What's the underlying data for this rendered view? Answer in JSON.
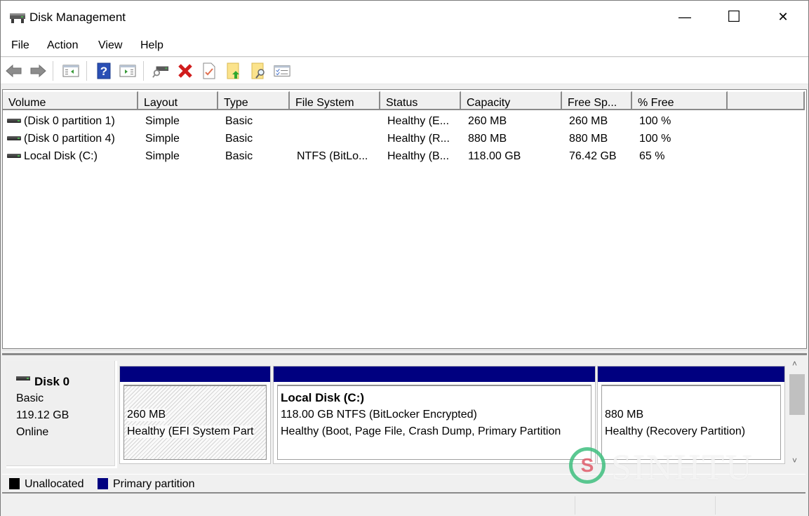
{
  "window": {
    "title": "Disk Management",
    "app_icon": "disk-management-icon",
    "controls": {
      "minimize": "—",
      "maximize": "☐",
      "close": "✕"
    }
  },
  "menu": [
    "File",
    "Action",
    "View",
    "Help"
  ],
  "toolbar": {
    "buttons": [
      {
        "icon": "back-arrow-icon"
      },
      {
        "icon": "forward-arrow-icon"
      },
      {
        "icon": "show-hide-console-tree-icon"
      },
      {
        "icon": "help-icon",
        "glyph": "?"
      },
      {
        "icon": "show-hide-action-pane-icon"
      },
      {
        "icon": "connect-virtual-disk-icon"
      },
      {
        "icon": "delete-icon",
        "glyph": "✖"
      },
      {
        "icon": "properties-icon",
        "glyph": "✓"
      },
      {
        "icon": "import-folder-icon",
        "glyph": "↑"
      },
      {
        "icon": "find-folder-icon"
      },
      {
        "icon": "checklist-icon"
      }
    ]
  },
  "volume_list": {
    "columns": [
      "Volume",
      "Layout",
      "Type",
      "File System",
      "Status",
      "Capacity",
      "Free Sp...",
      "% Free",
      ""
    ],
    "rows": [
      {
        "volume": "(Disk 0 partition 1)",
        "layout": "Simple",
        "type": "Basic",
        "file_system": "",
        "status": "Healthy (E...",
        "capacity": "260 MB",
        "free_space": "260 MB",
        "percent_free": "100 %"
      },
      {
        "volume": "(Disk 0 partition 4)",
        "layout": "Simple",
        "type": "Basic",
        "file_system": "",
        "status": "Healthy (R...",
        "capacity": "880 MB",
        "free_space": "880 MB",
        "percent_free": "100 %"
      },
      {
        "volume": "Local Disk (C:)",
        "layout": "Simple",
        "type": "Basic",
        "file_system": "NTFS (BitLo...",
        "status": "Healthy (B...",
        "capacity": "118.00 GB",
        "free_space": "76.42 GB",
        "percent_free": "65 %"
      }
    ]
  },
  "disk": {
    "name": "Disk 0",
    "type": "Basic",
    "size": "119.12 GB",
    "state": "Online",
    "partitions": [
      {
        "title": "",
        "line1": "260 MB",
        "line2": "Healthy (EFI System Part",
        "style": "hatched"
      },
      {
        "title": "Local Disk  (C:)",
        "line1": "118.00 GB NTFS (BitLocker Encrypted)",
        "line2": "Healthy (Boot, Page File, Crash Dump, Primary Partition",
        "style": "plain"
      },
      {
        "title": "",
        "line1": "880 MB",
        "line2": "Healthy (Recovery Partition)",
        "style": "plain"
      }
    ]
  },
  "legend": [
    {
      "label": "Unallocated",
      "color": "#000000"
    },
    {
      "label": "Primary partition",
      "color": "#000080"
    }
  ],
  "scrollbar": {
    "up": "˄",
    "down": "˅"
  },
  "watermark": {
    "logo": "S",
    "text": "SINHTU"
  }
}
